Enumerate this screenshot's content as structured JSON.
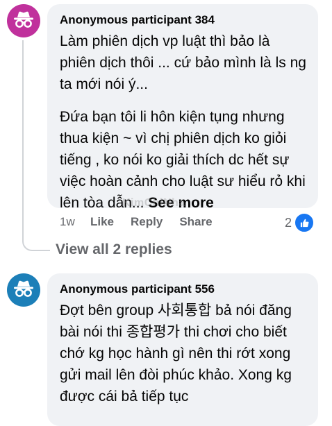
{
  "comments": [
    {
      "author": "Anonymous participant 384",
      "paragraphs": [
        "Làm phiên dịch vp luật thì bảo là phiên dịch thôi ... cứ bảo mình là ls ng ta mới nói ý...",
        "Đứa bạn tôi li hôn kiện tụng nhưng thua kiện ~ vì chị phiên dịch ko giỏi tiếng , ko nói ko giải thích dc hết sự việc hoàn cảnh cho luật sư hiểu rỏ khi lên tòa dẫn..."
      ],
      "see_more": "See more",
      "watermark": "KimChiNha",
      "age": "1w",
      "like_label": "Like",
      "reply_label": "Reply",
      "share_label": "Share",
      "reaction_count": "2",
      "view_replies": "View all 2 replies",
      "avatar_color": "#c0319c"
    },
    {
      "author": "Anonymous participant 556",
      "paragraphs": [
        "Đợt bên group 사회통합 bả nói đăng bài nói thi 종합평가 thi chơi cho biết chớ kg học hành gì nên thi rớt xong gửi mail lên đòi phúc khảo. Xong kg được cái bả tiếp tục"
      ],
      "avatar_color": "#1c7fb8"
    }
  ],
  "icons": {
    "avatar": "anonymous-incognito-icon",
    "reaction": "thumbs-up-icon"
  },
  "colors": {
    "like_blue": "#1877f2",
    "bubble_bg": "#f0f2f5",
    "meta_gray": "#65676b"
  }
}
